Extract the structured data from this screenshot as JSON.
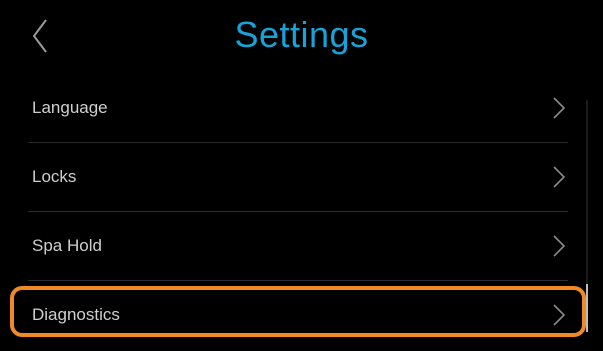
{
  "header": {
    "title": "Settings",
    "back_icon": "chevron-left-icon"
  },
  "menu": {
    "items": [
      {
        "label": "Language",
        "icon": "chevron-right-icon"
      },
      {
        "label": "Locks",
        "icon": "chevron-right-icon"
      },
      {
        "label": "Spa Hold",
        "icon": "chevron-right-icon"
      },
      {
        "label": "Diagnostics",
        "icon": "chevron-right-icon"
      }
    ]
  },
  "colors": {
    "background": "#000000",
    "title": "#17a3d8",
    "label": "#cfcfcf",
    "highlight": "#f08a24"
  }
}
